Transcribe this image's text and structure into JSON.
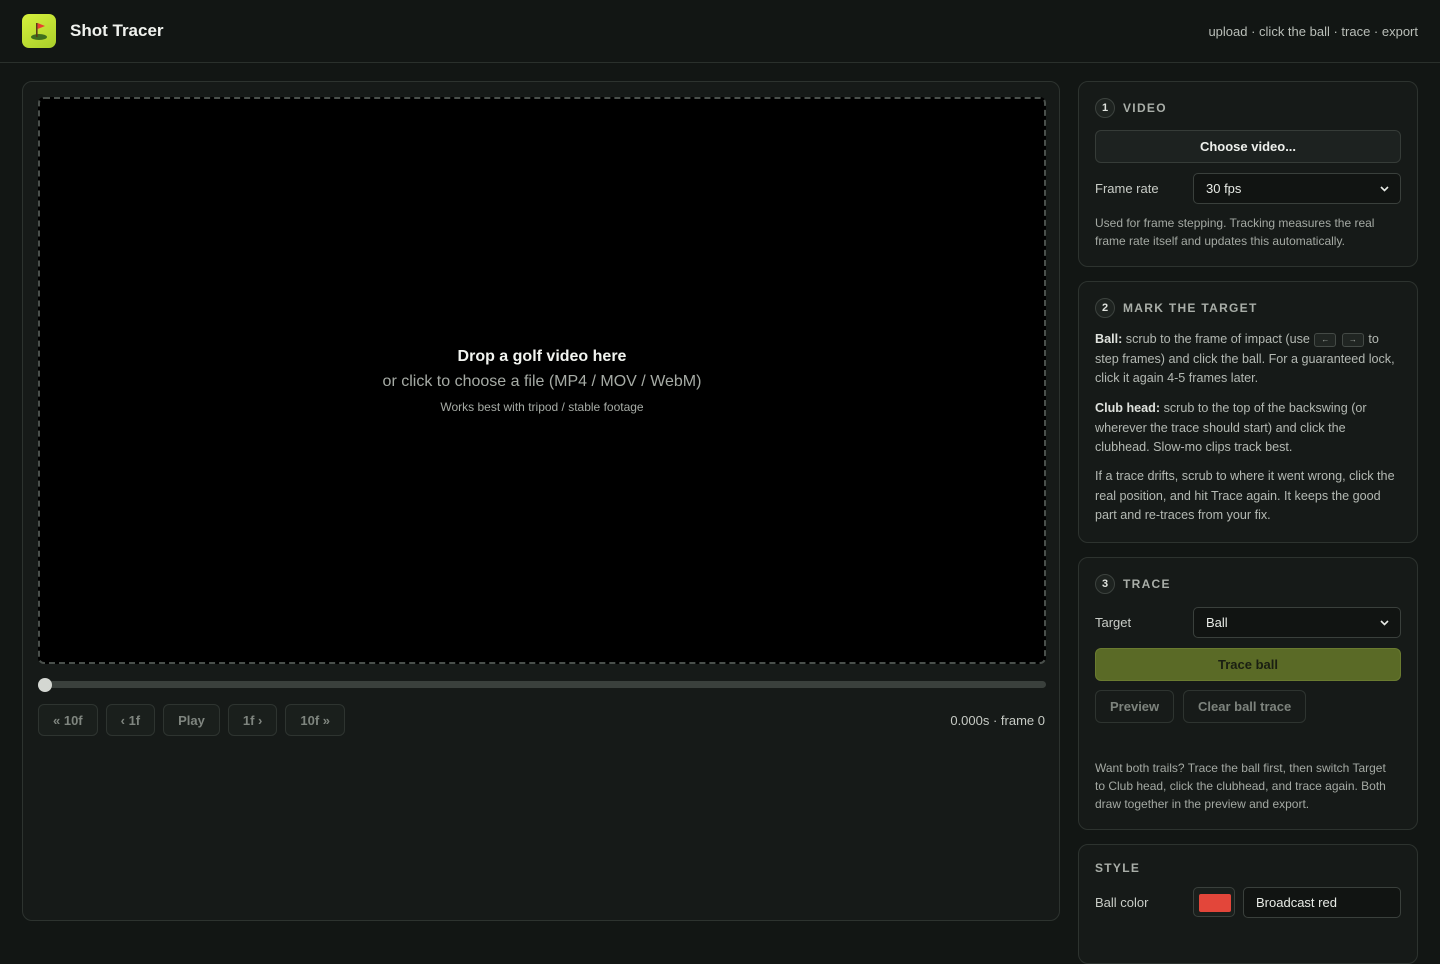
{
  "header": {
    "app_title": "Shot Tracer",
    "steps_hint": "upload · click the ball · trace · export",
    "logo_icon": "golf-flag-icon"
  },
  "player": {
    "drop_title": "Drop a golf video here",
    "drop_subtitle": "or click to choose a file (MP4 / MOV / WebM)",
    "drop_note": "Works best with tripod / stable footage",
    "scrub_position": 0,
    "controls": {
      "back10": "« 10f",
      "back1": "‹ 1f",
      "play": "Play",
      "fwd1": "1f ›",
      "fwd10": "10f »"
    },
    "time_readout": "0.000s · frame 0"
  },
  "video_card": {
    "step": "1",
    "title": "VIDEO",
    "choose_label": "Choose video...",
    "frame_rate_label": "Frame rate",
    "frame_rate_value": "30 fps",
    "help": "Used for frame stepping. Tracking measures the real frame rate itself and updates this automatically."
  },
  "target_card": {
    "step": "2",
    "title": "MARK THE TARGET",
    "ball_label": "Ball:",
    "ball_text_a": " scrub to the frame of impact (use ",
    "key_left": "←",
    "key_right": "→",
    "ball_text_b": " to step frames) and click the ball. For a guaranteed lock, click it again 4-5 frames later.",
    "club_label": "Club head:",
    "club_text": " scrub to the top of the backswing (or wherever the trace should start) and click the clubhead. Slow-mo clips track best.",
    "drift_text": "If a trace drifts, scrub to where it went wrong, click the real position, and hit Trace again. It keeps the good part and re-traces from your fix."
  },
  "trace_card": {
    "step": "3",
    "title": "TRACE",
    "target_label": "Target",
    "target_value": "Ball",
    "trace_button": "Trace ball",
    "preview_button": "Preview",
    "clear_button": "Clear ball trace",
    "help": "Want both trails? Trace the ball first, then switch Target to Club head, click the clubhead, and trace again. Both draw together in the preview and export."
  },
  "style_card": {
    "title": "STYLE",
    "ball_color_label": "Ball color",
    "ball_color": "#e3463a",
    "trail_style_value": "Broadcast red"
  }
}
